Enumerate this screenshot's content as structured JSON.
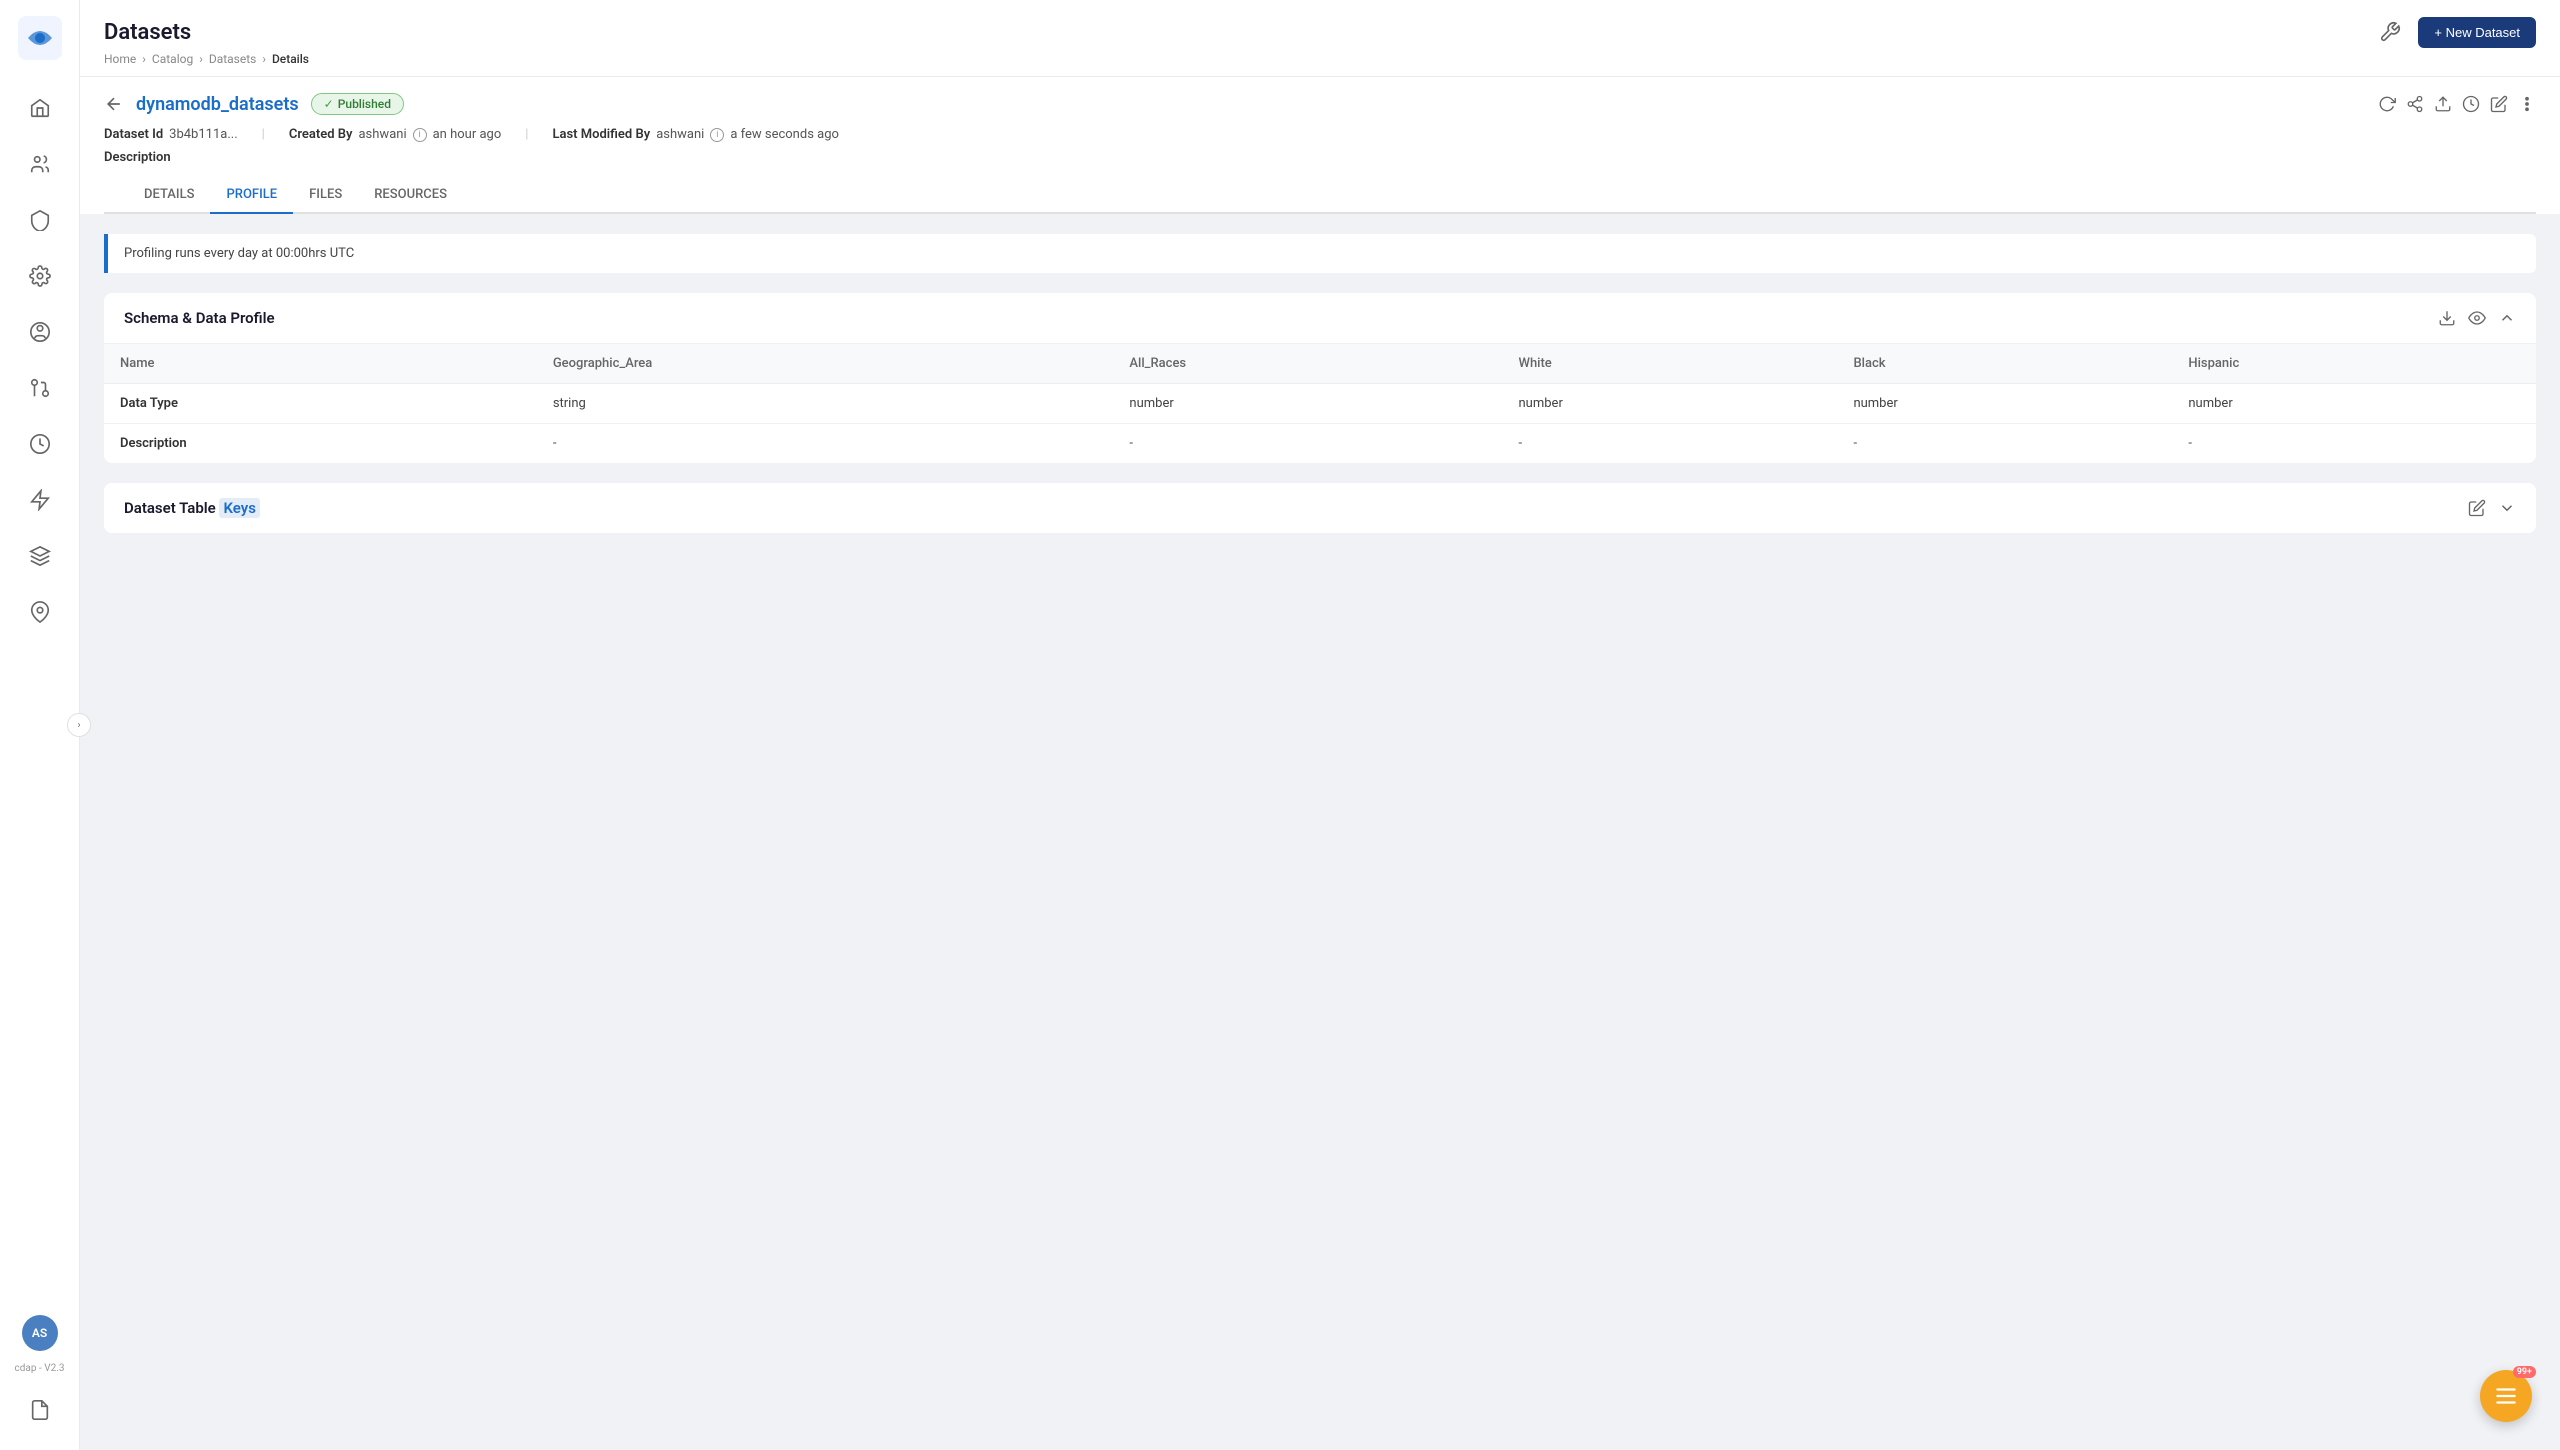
{
  "header": {
    "title": "Datasets",
    "breadcrumb": [
      "Home",
      "Catalog",
      "Datasets",
      "Details"
    ],
    "new_dataset_btn": "+ New Dataset"
  },
  "detail": {
    "dataset_name": "dynamodb_datasets",
    "status": "Published",
    "dataset_id_label": "Dataset Id",
    "dataset_id_value": "3b4b111a...",
    "created_by_label": "Created By",
    "created_by_value": "ashwani",
    "created_time": "an hour ago",
    "modified_label": "Last Modified By",
    "modified_by": "ashwani",
    "modified_time": "a few seconds ago",
    "description_label": "Description"
  },
  "tabs": [
    "DETAILS",
    "PROFILE",
    "FILES",
    "RESOURCES"
  ],
  "active_tab": "PROFILE",
  "info_banner": "Profiling runs every day at 00:00hrs UTC",
  "schema_section": {
    "title": "Schema & Data Profile",
    "columns": [
      "Name",
      "Geographic_Area",
      "All_Races",
      "White",
      "Black",
      "Hispanic"
    ],
    "rows": [
      {
        "label": "Data Type",
        "values": [
          "string",
          "number",
          "number",
          "number",
          "number"
        ]
      },
      {
        "label": "Description",
        "values": [
          "-",
          "-",
          "-",
          "-",
          "-"
        ]
      }
    ]
  },
  "keys_section": {
    "title": "Dataset Table",
    "title_highlight": "Keys"
  },
  "floating_btn": {
    "badge": "99+"
  },
  "sidebar": {
    "version": "cdap - V2.3",
    "avatar_initials": "AS",
    "items": [
      {
        "name": "home",
        "icon": "home"
      },
      {
        "name": "people",
        "icon": "people"
      },
      {
        "name": "shield",
        "icon": "shield"
      },
      {
        "name": "settings",
        "icon": "settings"
      },
      {
        "name": "person-circle",
        "icon": "person-circle"
      },
      {
        "name": "git",
        "icon": "git"
      },
      {
        "name": "clock",
        "icon": "clock"
      },
      {
        "name": "lightning",
        "icon": "lightning"
      },
      {
        "name": "layers",
        "icon": "layers"
      },
      {
        "name": "package",
        "icon": "package"
      },
      {
        "name": "file",
        "icon": "file"
      }
    ]
  }
}
